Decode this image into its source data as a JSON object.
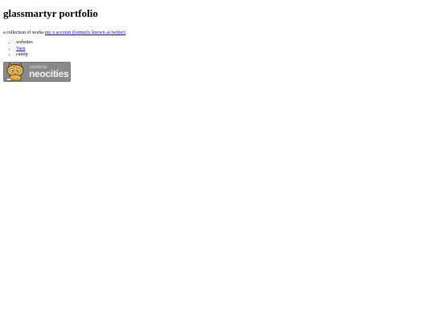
{
  "page": {
    "title": "glassmartyr portfolio",
    "tagline_prefix": "a collection of works",
    "tagline_link": "my x account (formerly known as twitter)"
  },
  "list": {
    "items": [
      {
        "label": "websites",
        "is_link": false
      },
      {
        "label": "Yarn",
        "is_link": true
      },
      {
        "label": "catnip",
        "is_link": false
      }
    ]
  },
  "badge": {
    "hosted_text": "hosted by",
    "brand_text": "neocities",
    "icon": "neocities-cat-icon"
  },
  "colors": {
    "link": "#0000ee",
    "badge_bg": "#8a8a8a",
    "cat_orange": "#f2b33d"
  }
}
